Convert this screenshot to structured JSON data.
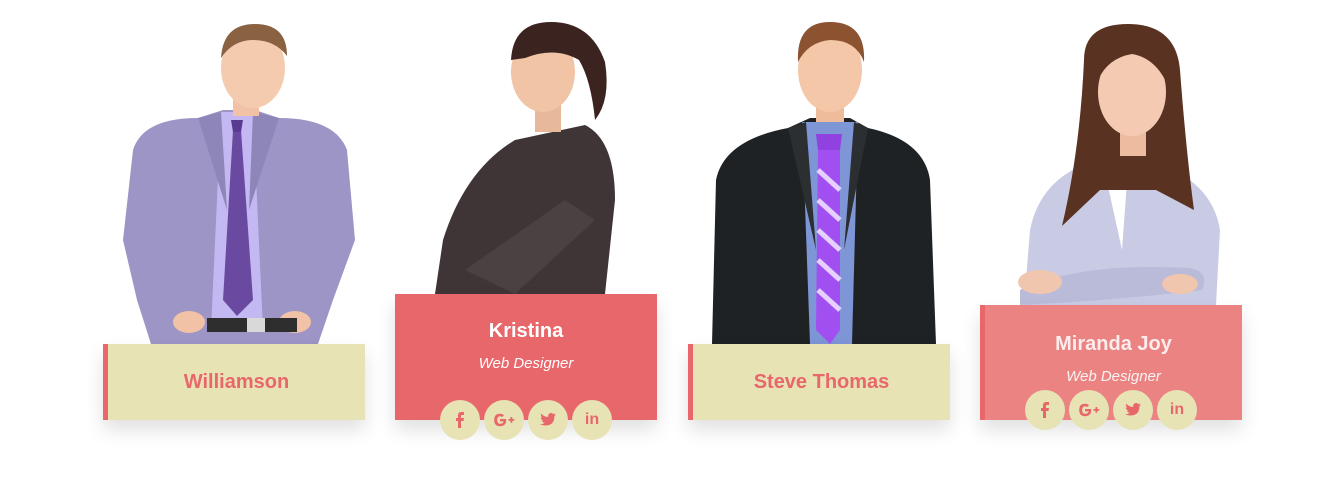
{
  "colors": {
    "card_light": "#e7e3b5",
    "card_coral": "#e8676b",
    "card_coral_soft": "#eb8383",
    "accent": "#e8676b"
  },
  "team": [
    {
      "name": "Williamson"
    },
    {
      "name": "Kristina",
      "role": "Web Designer"
    },
    {
      "name": "Steve Thomas"
    },
    {
      "name": "Miranda Joy",
      "role": "Web Designer"
    }
  ],
  "social_icons": [
    "facebook-icon",
    "google-plus-icon",
    "twitter-icon",
    "linkedin-icon"
  ],
  "social_labels": {
    "linkedin": "in"
  }
}
